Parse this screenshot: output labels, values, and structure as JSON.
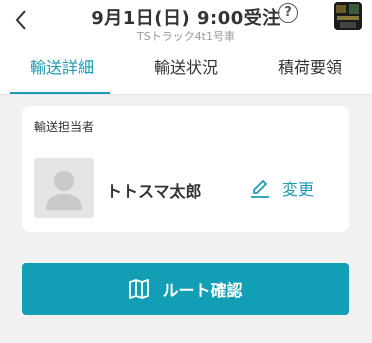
{
  "header": {
    "title": "9月1日(日) 9:00受注",
    "subtitle": "TSトラック4t1号車",
    "help_label": "?",
    "back_icon": "chevron-left-icon",
    "help_icon": "help-circle-icon"
  },
  "tabs": [
    {
      "label": "輸送詳細",
      "active": true
    },
    {
      "label": "輸送状況",
      "active": false
    },
    {
      "label": "積荷要領",
      "active": false
    }
  ],
  "assignee": {
    "section_label": "輸送担当者",
    "name": "トトスマ太郎",
    "change_label": "変更",
    "change_icon": "pencil-icon",
    "avatar_icon": "user-placeholder-icon"
  },
  "route_button": {
    "label": "ルート確認",
    "icon": "map-icon"
  },
  "colors": {
    "accent": "#1a9cb5",
    "button_bg": "#129eb4",
    "background": "#f1f1f1"
  }
}
